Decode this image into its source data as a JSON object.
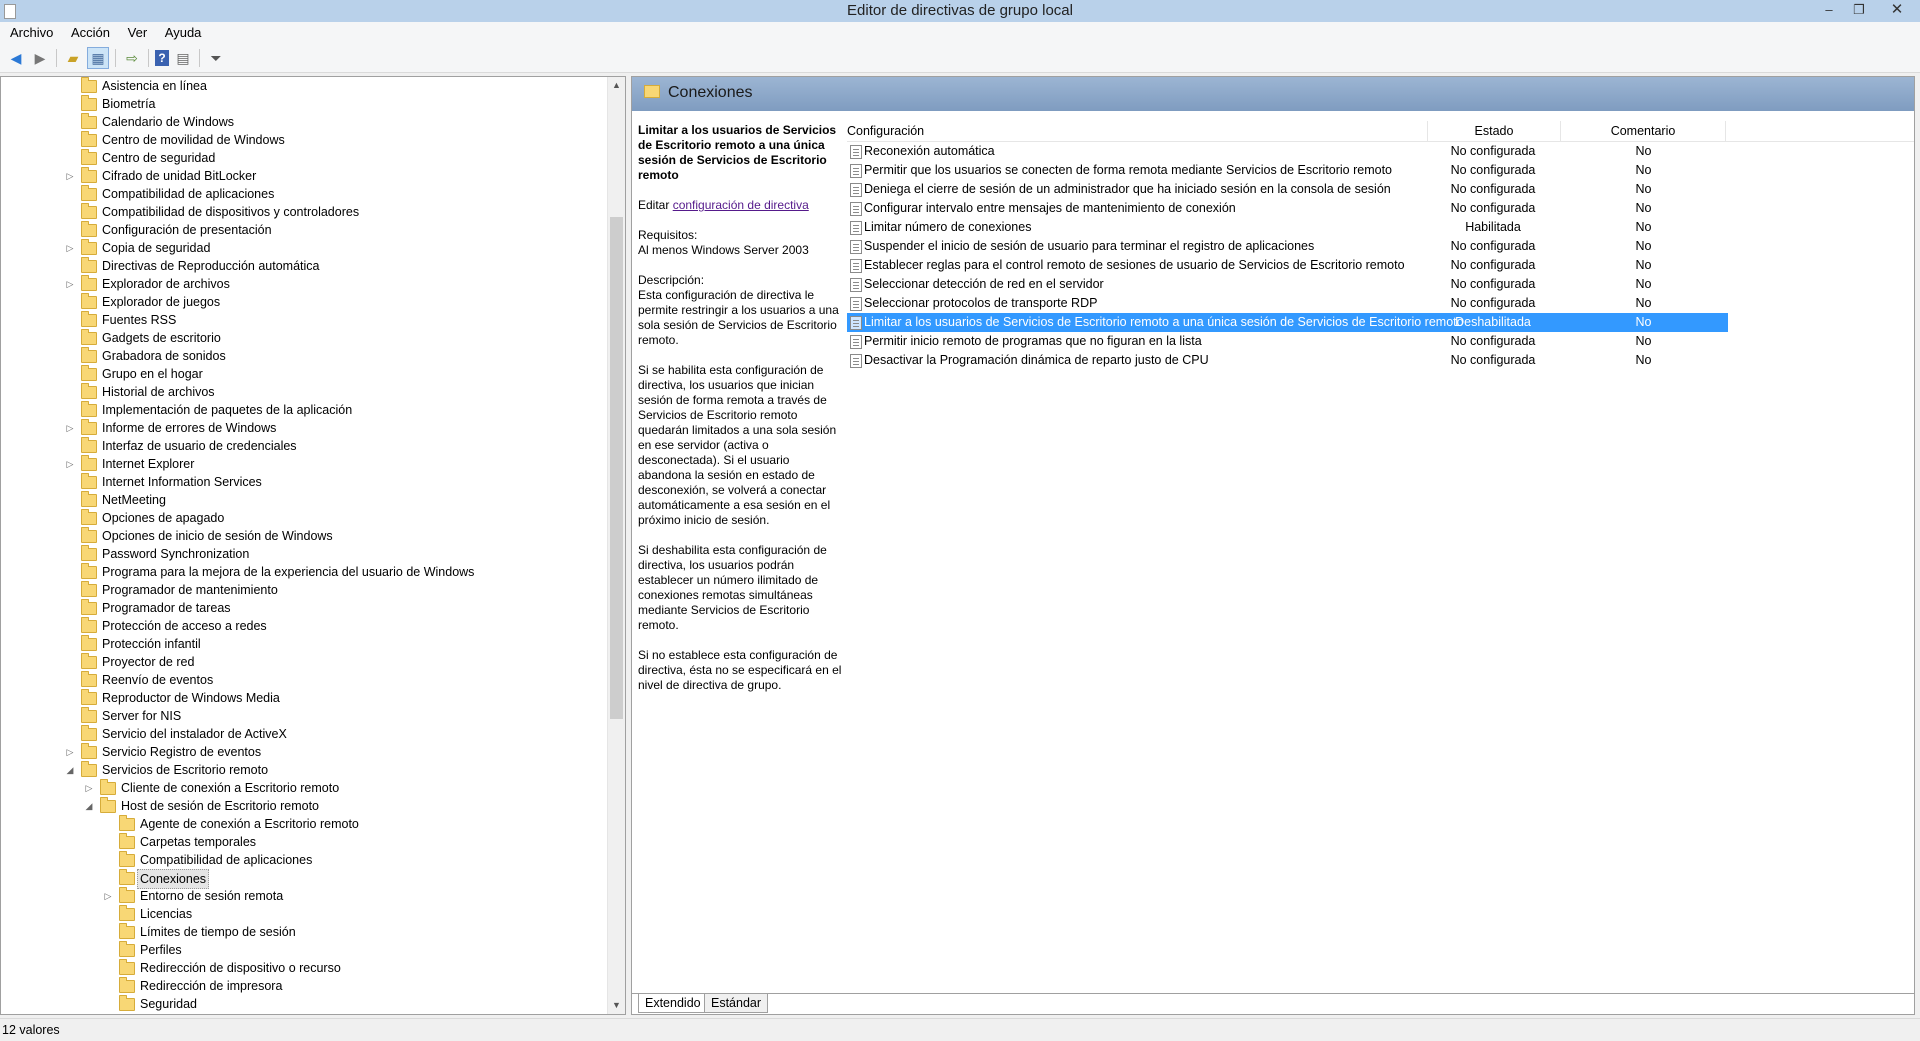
{
  "window": {
    "title": "Editor de directivas de grupo local",
    "min": "–",
    "max": "❐",
    "close": "✕"
  },
  "menu": [
    "Archivo",
    "Acción",
    "Ver",
    "Ayuda"
  ],
  "tree": {
    "nodes": [
      {
        "label": "Asistencia en línea",
        "level": 0,
        "expander": ""
      },
      {
        "label": "Biometría",
        "level": 0,
        "expander": ""
      },
      {
        "label": "Calendario de Windows",
        "level": 0,
        "expander": ""
      },
      {
        "label": "Centro de movilidad de Windows",
        "level": 0,
        "expander": ""
      },
      {
        "label": "Centro de seguridad",
        "level": 0,
        "expander": ""
      },
      {
        "label": "Cifrado de unidad BitLocker",
        "level": 0,
        "expander": "collapsed"
      },
      {
        "label": "Compatibilidad de aplicaciones",
        "level": 0,
        "expander": ""
      },
      {
        "label": "Compatibilidad de dispositivos y controladores",
        "level": 0,
        "expander": ""
      },
      {
        "label": "Configuración de presentación",
        "level": 0,
        "expander": ""
      },
      {
        "label": "Copia de seguridad",
        "level": 0,
        "expander": "collapsed"
      },
      {
        "label": "Directivas de Reproducción automática",
        "level": 0,
        "expander": ""
      },
      {
        "label": "Explorador de archivos",
        "level": 0,
        "expander": "collapsed"
      },
      {
        "label": "Explorador de juegos",
        "level": 0,
        "expander": ""
      },
      {
        "label": "Fuentes RSS",
        "level": 0,
        "expander": ""
      },
      {
        "label": "Gadgets de escritorio",
        "level": 0,
        "expander": ""
      },
      {
        "label": "Grabadora de sonidos",
        "level": 0,
        "expander": ""
      },
      {
        "label": "Grupo en el hogar",
        "level": 0,
        "expander": ""
      },
      {
        "label": "Historial de archivos",
        "level": 0,
        "expander": ""
      },
      {
        "label": "Implementación de paquetes de la aplicación",
        "level": 0,
        "expander": ""
      },
      {
        "label": "Informe de errores de Windows",
        "level": 0,
        "expander": "collapsed"
      },
      {
        "label": "Interfaz de usuario de credenciales",
        "level": 0,
        "expander": ""
      },
      {
        "label": "Internet Explorer",
        "level": 0,
        "expander": "collapsed"
      },
      {
        "label": "Internet Information Services",
        "level": 0,
        "expander": ""
      },
      {
        "label": "NetMeeting",
        "level": 0,
        "expander": ""
      },
      {
        "label": "Opciones de apagado",
        "level": 0,
        "expander": ""
      },
      {
        "label": "Opciones de inicio de sesión de Windows",
        "level": 0,
        "expander": ""
      },
      {
        "label": "Password Synchronization",
        "level": 0,
        "expander": ""
      },
      {
        "label": "Programa para la mejora de la experiencia del usuario de Windows",
        "level": 0,
        "expander": ""
      },
      {
        "label": "Programador de mantenimiento",
        "level": 0,
        "expander": ""
      },
      {
        "label": "Programador de tareas",
        "level": 0,
        "expander": ""
      },
      {
        "label": "Protección de acceso a redes",
        "level": 0,
        "expander": ""
      },
      {
        "label": "Protección infantil",
        "level": 0,
        "expander": ""
      },
      {
        "label": "Proyector de red",
        "level": 0,
        "expander": ""
      },
      {
        "label": "Reenvío de eventos",
        "level": 0,
        "expander": ""
      },
      {
        "label": "Reproductor de Windows Media",
        "level": 0,
        "expander": ""
      },
      {
        "label": "Server for NIS",
        "level": 0,
        "expander": ""
      },
      {
        "label": "Servicio del instalador de ActiveX",
        "level": 0,
        "expander": ""
      },
      {
        "label": "Servicio Registro de eventos",
        "level": 0,
        "expander": "collapsed"
      },
      {
        "label": "Servicios de Escritorio remoto",
        "level": 0,
        "expander": "expanded"
      },
      {
        "label": "Cliente de conexión a Escritorio remoto",
        "level": 1,
        "expander": "collapsed"
      },
      {
        "label": "Host de sesión de Escritorio remoto",
        "level": 1,
        "expander": "expanded"
      },
      {
        "label": "Agente de conexión a Escritorio remoto",
        "level": 2,
        "expander": ""
      },
      {
        "label": "Carpetas temporales",
        "level": 2,
        "expander": ""
      },
      {
        "label": "Compatibilidad de aplicaciones",
        "level": 2,
        "expander": ""
      },
      {
        "label": "Conexiones",
        "level": 2,
        "expander": "",
        "selected": true
      },
      {
        "label": "Entorno de sesión remota",
        "level": 2,
        "expander": "collapsed"
      },
      {
        "label": "Licencias",
        "level": 2,
        "expander": ""
      },
      {
        "label": "Límites de tiempo de sesión",
        "level": 2,
        "expander": ""
      },
      {
        "label": "Perfiles",
        "level": 2,
        "expander": ""
      },
      {
        "label": "Redirección de dispositivo o recurso",
        "level": 2,
        "expander": ""
      },
      {
        "label": "Redirección de impresora",
        "level": 2,
        "expander": ""
      },
      {
        "label": "Seguridad",
        "level": 2,
        "expander": ""
      }
    ]
  },
  "right": {
    "header_title": "Conexiones",
    "description": {
      "title": "Limitar a los usuarios de Servicios de Escritorio remoto a una única sesión de Servicios de Escritorio remoto",
      "edit_prefix": "Editar ",
      "edit_link": "configuración de directiva",
      "requirements_label": "Requisitos:",
      "requirements_value": "Al menos Windows Server 2003",
      "description_label": "Descripción:",
      "paragraphs": [
        "Esta configuración de directiva le permite restringir a los usuarios a una sola sesión de Servicios de Escritorio remoto.",
        "Si se habilita esta configuración de directiva, los usuarios que inician sesión de forma remota a través de Servicios de Escritorio remoto quedarán limitados a una sola sesión en ese servidor (activa o desconectada). Si el usuario abandona la sesión en estado de desconexión, se volverá a conectar automáticamente a esa sesión en el próximo inicio de sesión.",
        "Si deshabilita esta configuración de directiva, los usuarios podrán establecer un número ilimitado de conexiones remotas simultáneas mediante Servicios de Escritorio remoto.",
        "Si no establece esta configuración de directiva, ésta no se especificará en el nivel de directiva de grupo."
      ]
    },
    "columns": {
      "setting": "Configuración",
      "state": "Estado",
      "comment": "Comentario"
    },
    "rows": [
      {
        "name": "Reconexión automática",
        "state": "No configurada",
        "comment": "No"
      },
      {
        "name": "Permitir que los usuarios se conecten de forma remota mediante Servicios de Escritorio remoto",
        "state": "No configurada",
        "comment": "No"
      },
      {
        "name": "Deniega el cierre de sesión de un administrador que ha iniciado sesión en la consola de sesión",
        "state": "No configurada",
        "comment": "No"
      },
      {
        "name": "Configurar intervalo entre mensajes de mantenimiento de conexión",
        "state": "No configurada",
        "comment": "No"
      },
      {
        "name": "Limitar número de conexiones",
        "state": "Habilitada",
        "comment": "No"
      },
      {
        "name": "Suspender el inicio de sesión de usuario para terminar el registro de aplicaciones",
        "state": "No configurada",
        "comment": "No"
      },
      {
        "name": "Establecer reglas para el control remoto de sesiones de usuario de Servicios de Escritorio remoto",
        "state": "No configurada",
        "comment": "No"
      },
      {
        "name": "Seleccionar detección de red en el servidor",
        "state": "No configurada",
        "comment": "No"
      },
      {
        "name": "Seleccionar protocolos de transporte RDP",
        "state": "No configurada",
        "comment": "No"
      },
      {
        "name": "Limitar a los usuarios de Servicios de Escritorio remoto a una única sesión de Servicios de Escritorio remoto",
        "state": "Deshabilitada",
        "comment": "No",
        "selected": true
      },
      {
        "name": "Permitir inicio remoto de programas que no figuran en la lista",
        "state": "No configurada",
        "comment": "No"
      },
      {
        "name": "Desactivar la Programación dinámica de reparto justo de CPU",
        "state": "No configurada",
        "comment": "No"
      }
    ],
    "tabs": [
      "Extendido",
      "Estándar"
    ]
  },
  "status": {
    "text": "12 valores"
  },
  "colors": {
    "selection": "#3399ff",
    "header_band": "#8faacb",
    "link": "#551a8b"
  }
}
